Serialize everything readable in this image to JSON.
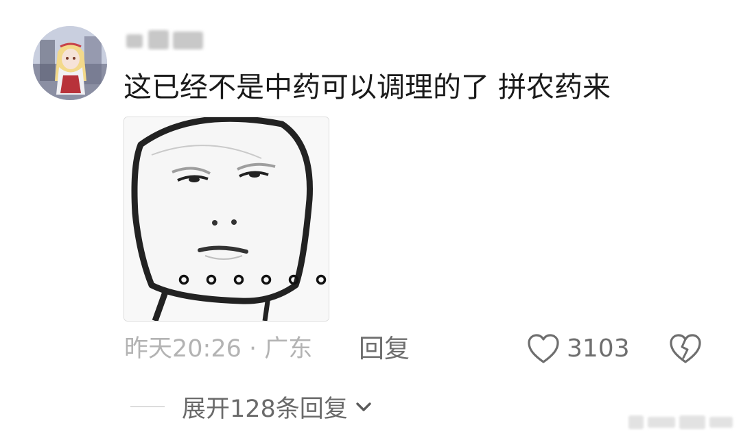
{
  "comment": {
    "text": "这已经不是中药可以调理的了 拼农药来",
    "meta": "昨天20:26 · 广东",
    "reply_label": "回复",
    "like_count": "3103",
    "expand_label": "展开128条回复"
  },
  "icons": {
    "like": "heart-outline-icon",
    "dislike": "broken-heart-icon",
    "expand": "chevron-down-icon"
  }
}
